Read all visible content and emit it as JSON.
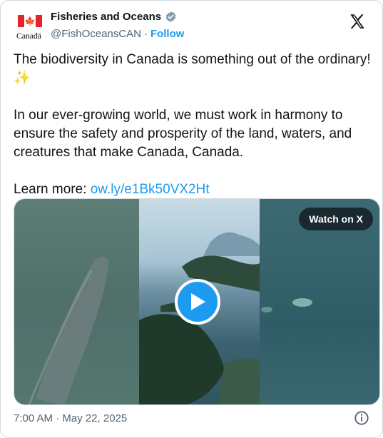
{
  "author": {
    "name": "Fisheries and Oceans",
    "handle": "@FishOceansCAN",
    "separator": "·",
    "follow_label": "Follow",
    "logo_wordmark": "Canadä"
  },
  "post": {
    "line1": "The biodiversity in Canada is something out of the ordinary! ✨",
    "line2": "In our ever-growing world, we must work in harmony to ensure the safety and prosperity of the land, waters, and creatures that make Canada, Canada.",
    "learn_prefix": "Learn more: ",
    "link_text": "ow.ly/e1Bk50VX2Ht"
  },
  "media": {
    "watch_label": "Watch on X",
    "play_icon": "play-icon"
  },
  "footer": {
    "timestamp": "7:00 AM · May 22, 2025",
    "info_icon": "info-icon"
  },
  "colors": {
    "accent": "#1d9bf0",
    "text": "#0f1419",
    "muted": "#536471",
    "flag_red": "#e3242b"
  }
}
